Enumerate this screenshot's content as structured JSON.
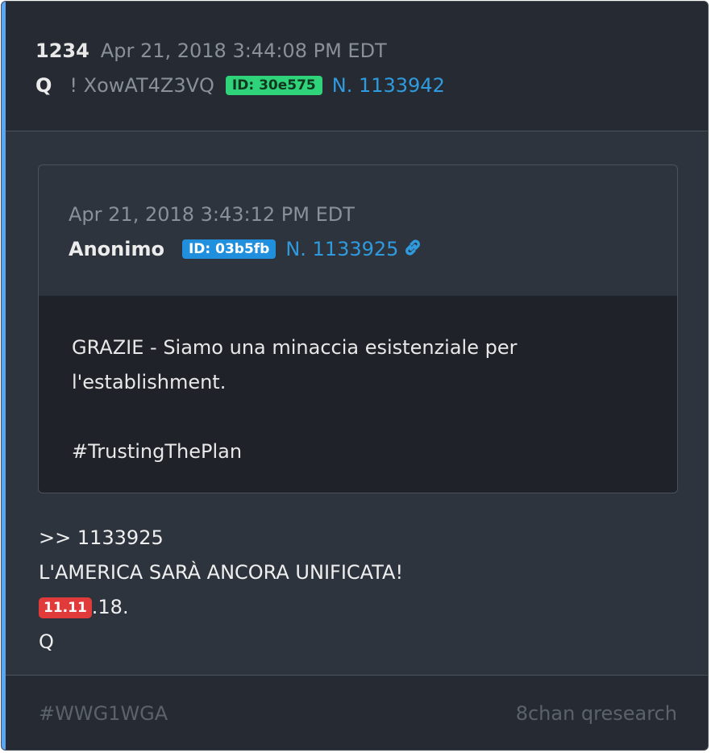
{
  "post": {
    "number": "1234",
    "date": "Apr 21, 2018 3:44:08 PM EDT",
    "author": "Q",
    "tripcode": "! XowAT4Z3VQ",
    "id_badge": "ID: 30e575",
    "ref_link": "N. 1133942"
  },
  "quoted": {
    "date": "Apr 21, 2018 3:43:12 PM EDT",
    "author": "Anonimo",
    "id_badge": "ID: 03b5fb",
    "ref_link": "N. 1133925",
    "link_icon": "chain-link-icon",
    "body_line1": "GRAZIE - Siamo una minaccia esistenziale per",
    "body_line2": "l'establishment.",
    "body_line3": "#TrustingThePlan"
  },
  "message": {
    "line1": ">> 1133925",
    "line2": "L'AMERICA SARÀ ANCORA UNIFICATA!",
    "badge": "11.11",
    "line3_suffix": ".18.",
    "line4": "Q"
  },
  "footer": {
    "hashtag": "#WWG1WGA",
    "source": "8chan qresearch"
  },
  "colors": {
    "accent": "#5aa6f2",
    "id_green": "#2fd37a",
    "id_blue": "#1f8fde",
    "link": "#2f9bde",
    "red_badge": "#e03a3a"
  }
}
